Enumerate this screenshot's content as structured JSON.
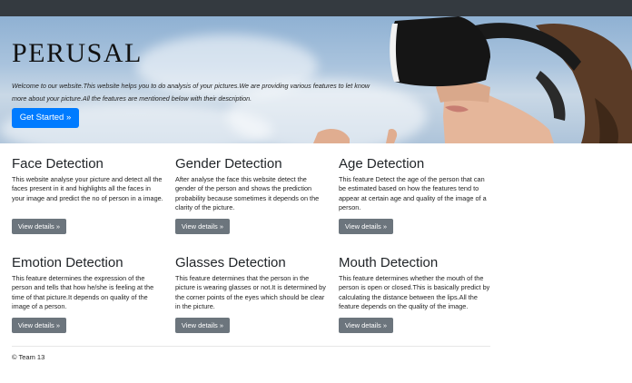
{
  "hero": {
    "title": "PERUSAL",
    "text": "Welcome to our website.This website helps you to do analysis of your pictures.We are providing various features to let know more about your picture.All the features are mentioned below with their description.",
    "button_label": "Get Started »"
  },
  "features": [
    {
      "title": "Face Detection",
      "text": "This website analyse your picture and detect all the faces present in it and highlights all the faces in your image and predict the no of person in a image.",
      "button_label": "View details »"
    },
    {
      "title": "Gender Detection",
      "text": "After analyse the face this website detect the gender of the person and shows the prediction probability because sometimes it depends on the clarity of the picture.",
      "button_label": "View details »"
    },
    {
      "title": "Age Detection",
      "text": "This feature Detect the age of the person that can be estimated based on how the features tend to appear at certain age and quality of the image of a person.",
      "button_label": "View details »"
    },
    {
      "title": "Emotion Detection",
      "text": "This feature determines the expression of the person and tells that how he/she is feeling at the time of that picture.It depends on quality of the image of a person.",
      "button_label": "View details »"
    },
    {
      "title": "Glasses Detection",
      "text": "This feature determines that the person in the picture is wearing glasses or not.It is determined by the corner points of the eyes which should be clear in the picture.",
      "button_label": "View details »"
    },
    {
      "title": "Mouth Detection",
      "text": "This feature determines whether the mouth of the person is open or closed.This is basically predict by calculating the distance between the lips.All the feature depends on the quality of the image.",
      "button_label": "View details »"
    }
  ],
  "footer": {
    "text": "© Team 13"
  },
  "colors": {
    "navbar": "#343a40",
    "primary": "#007bff",
    "secondary": "#6c757d"
  }
}
